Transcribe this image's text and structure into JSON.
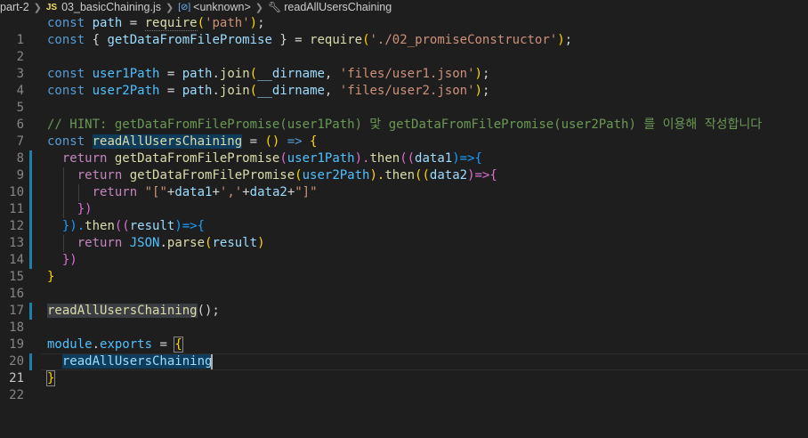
{
  "breadcrumb": {
    "folder": "part-2",
    "file_badge": "JS",
    "file": "03_basicChaining.js",
    "symbol1": "<unknown>",
    "symbol2": "readAllUsersChaining"
  },
  "lines": {
    "l1": {
      "n": "1",
      "a": "const",
      "b": "path",
      "c": " = ",
      "d": "require",
      "e": "(",
      "f": "'path'",
      "g": ");"
    },
    "l2": {
      "n": "2",
      "a": "const",
      "b": " { ",
      "c": "getDataFromFilePromise",
      "d": " } = ",
      "e": "require",
      "f": "(",
      "g": "'./02_promiseConstructor'",
      "h": ");"
    },
    "l3": {
      "n": "3"
    },
    "l4": {
      "n": "4",
      "a": "const",
      "b": "user1Path",
      "c": " = ",
      "d": "path",
      "e": ".",
      "f": "join",
      "g": "(",
      "h": "__dirname",
      "i": ", ",
      "j": "'files/user1.json'",
      "k": ");"
    },
    "l5": {
      "n": "5",
      "a": "const",
      "b": "user2Path",
      "c": " = ",
      "d": "path",
      "e": ".",
      "f": "join",
      "g": "(",
      "h": "__dirname",
      "i": ", ",
      "j": "'files/user2.json'",
      "k": ");"
    },
    "l6": {
      "n": "6"
    },
    "l7": {
      "n": "7",
      "a": "// HINT: getDataFromFilePromise(user1Path) 맟 getDataFromFilePromise(user2Path) 를 이용해 작성합니다"
    },
    "l8": {
      "n": "8",
      "a": "const",
      "b": "readAllUsersChaining",
      "c": " = ",
      "d": "()",
      "e": " => ",
      "f": "{"
    },
    "l9": {
      "n": "9",
      "a": "return",
      "b": "getDataFromFilePromise",
      "c": "(",
      "d": "user1Path",
      "e": ").",
      "f": "then",
      "g": "((",
      "h": "data1",
      "i": ")=>",
      "j": "{"
    },
    "l10": {
      "n": "10",
      "a": "return",
      "b": "getDataFromFilePromise",
      "c": "(",
      "d": "user2Path",
      "e": ").",
      "f": "then",
      "g": "((",
      "h": "data2",
      "i": ")=>",
      "j": "{"
    },
    "l11": {
      "n": "11",
      "a": "return",
      "b": "\"[\"",
      "c": "+",
      "d": "data1",
      "e": "+",
      "f": "','",
      "g": "+",
      "h": "data2",
      "i": "+",
      "j": "\"]\""
    },
    "l12": {
      "n": "12",
      "a": "})"
    },
    "l13": {
      "n": "13",
      "a": "}).",
      "b": "then",
      "c": "((",
      "d": "result",
      "e": ")=>",
      "f": "{"
    },
    "l14": {
      "n": "14",
      "a": "return",
      "b": "JSON",
      "c": ".",
      "d": "parse",
      "e": "(",
      "f": "result",
      "g": ")"
    },
    "l15": {
      "n": "15",
      "a": "})"
    },
    "l16": {
      "n": "16",
      "a": "}"
    },
    "l17": {
      "n": "17"
    },
    "l18": {
      "n": "18",
      "a": "readAllUsersChaining",
      "b": "();"
    },
    "l19": {
      "n": "19"
    },
    "l20": {
      "n": "20",
      "a": "module",
      "b": ".",
      "c": "exports",
      "d": " = ",
      "e": "{"
    },
    "l21": {
      "n": "21",
      "a": "readAllUsersChaining"
    },
    "l22": {
      "n": "22",
      "a": "}"
    }
  }
}
